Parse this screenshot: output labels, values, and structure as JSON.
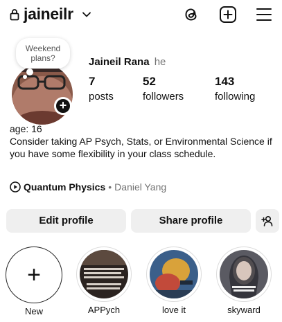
{
  "header": {
    "username": "jaineilr",
    "icons": [
      "lock-icon",
      "chevron-down-icon",
      "threads-icon",
      "add-square-icon",
      "menu-icon"
    ]
  },
  "profile": {
    "note": "Weekend plans?",
    "full_name": "Jaineil Rana",
    "pronoun": "he",
    "stats": {
      "posts": {
        "value": "7",
        "label": "posts"
      },
      "followers": {
        "value": "52",
        "label": "followers"
      },
      "following": {
        "value": "143",
        "label": "following"
      }
    }
  },
  "bio": {
    "age": "age: 16",
    "text": "Consider taking AP Psych, Stats, or Environmental Science if you have some flexibility in your class schedule."
  },
  "music": {
    "song": "Quantum Physics",
    "separator": "•",
    "artist": "Daniel Yang"
  },
  "actions": {
    "edit": "Edit profile",
    "share": "Share profile"
  },
  "highlights": {
    "new_label": "New",
    "items": [
      {
        "label": "APPych",
        "thumb_text": "Not the AP Psych is gonna be one of my fav courses this year. So many benefits like guaranteed class, easy A, college credit, etc."
      },
      {
        "label": "love it"
      },
      {
        "label": "skyward"
      }
    ]
  },
  "colors": {
    "button_bg": "#efefef",
    "secondary_text": "#737373"
  }
}
